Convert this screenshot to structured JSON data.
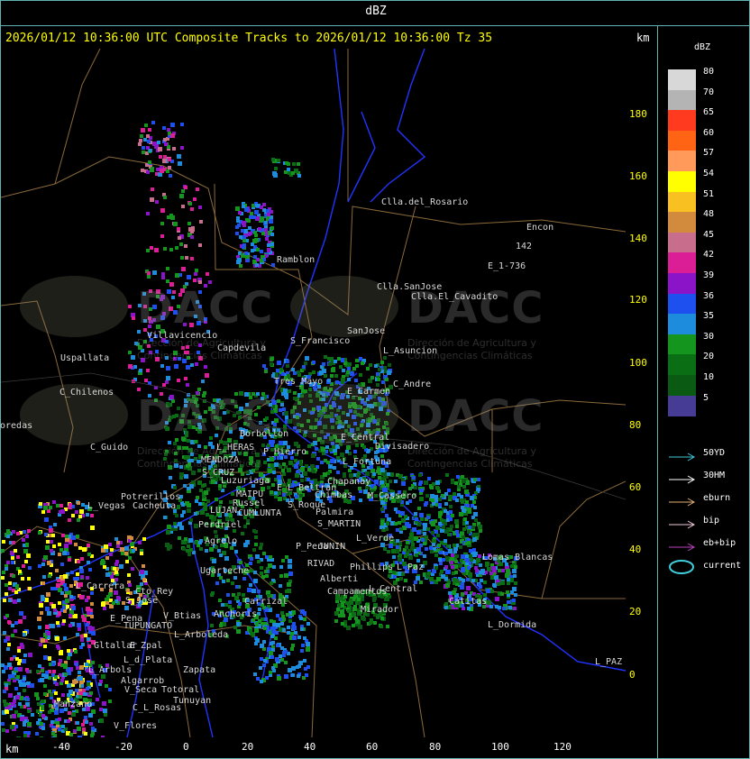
{
  "window": {
    "title": "dBZ",
    "header": "2026/01/12 10:36:00 UTC Composite Tracks to 2026/01/12 10:36:00 Tz 35",
    "km_label_top": "km",
    "km_label_bottom": "km"
  },
  "axes": {
    "y_ticks": [
      "180",
      "160",
      "140",
      "120",
      "100",
      "80",
      "60",
      "40",
      "20",
      "0"
    ],
    "x_ticks": [
      "-40",
      "-20",
      "0",
      "20",
      "40",
      "60",
      "80",
      "100",
      "120"
    ]
  },
  "legend": {
    "title": "dBZ",
    "levels": [
      {
        "label": "80",
        "color": "#d8d8d8"
      },
      {
        "label": "70",
        "color": "#b4b4b4"
      },
      {
        "label": "65",
        "color": "#ff3a1e"
      },
      {
        "label": "60",
        "color": "#ff6414"
      },
      {
        "label": "57",
        "color": "#ff9a5a"
      },
      {
        "label": "54",
        "color": "#ffff00"
      },
      {
        "label": "51",
        "color": "#f8c020"
      },
      {
        "label": "48",
        "color": "#d28a3c"
      },
      {
        "label": "45",
        "color": "#c86e8c"
      },
      {
        "label": "42",
        "color": "#dc1e96"
      },
      {
        "label": "39",
        "color": "#8c14c8"
      },
      {
        "label": "36",
        "color": "#1e50f0"
      },
      {
        "label": "35",
        "color": "#1e8cdc"
      },
      {
        "label": "30",
        "color": "#14961e"
      },
      {
        "label": "20",
        "color": "#0a6e14"
      },
      {
        "label": "10",
        "color": "#0a5a14"
      },
      {
        "label": "5",
        "color": "#463c96"
      }
    ],
    "tracks": [
      {
        "label": "50YD",
        "color": "#40c8d8"
      },
      {
        "label": "30HM",
        "color": "#ffffff"
      },
      {
        "label": "eburn",
        "color": "#e0b070"
      },
      {
        "label": "bip",
        "color": "#f0c8d8"
      },
      {
        "label": "eb+bip",
        "color": "#c040c0"
      },
      {
        "label": "current",
        "color": "#40d0e0"
      }
    ]
  },
  "watermark": {
    "brand": "DACC",
    "line1": "Dirección de Agricultura",
    "line2": "y Contingencias Climáticas"
  },
  "places": [
    "Clla.del_Rosario",
    "Encon",
    "142",
    "E_1-736",
    "Ramblon",
    "Clla.SanJose",
    "Clla.El_Cavadito",
    "Villavicencio",
    "Uspallata",
    "C_Chilenos",
    "Capdevila",
    "S_Francisco",
    "SanJose",
    "L_Asuncion",
    "Tres_Mayo",
    "C_Andre",
    "E_Carmen",
    "oredas",
    "C_Guido",
    "L_HERAS",
    "Borbollon",
    "P_Hierro",
    "Divisadero",
    "E_Central",
    "L_Fortuna",
    "MENDOZA",
    "S_CRUZ",
    "Luzuriaga",
    "Chapanay",
    "E_L_Beltran",
    "M_Cassero",
    "Potrerillos",
    "L_Vegas",
    "Cacheuta",
    "MAIPU",
    "Russel",
    "LUJAN",
    "CUMLUNTA",
    "Chimbas",
    "S_Roque",
    "Palmira",
    "S_MARTIN",
    "Perdriel",
    "Agrelo",
    "L_Verde",
    "P_Pena",
    "JUNIN",
    "RIVAD",
    "Phillips",
    "L_Paz",
    "Ugarteche",
    "Lomas_Blancas",
    "L_Carrera",
    "Cto_Rey",
    "S_Jose",
    "Alberti",
    "Campamentos",
    "L_Central",
    "Catitas",
    "E_Pena",
    "TUPUNGATO",
    "Anchoris",
    "Carrizal",
    "V_Btias",
    "L_Arboleda",
    "Mirador",
    "L_Dormida",
    "Gltallar",
    "E_Zpal",
    "L_d_Plata",
    "Zapata",
    "L_Arbols",
    "L_PAZ",
    "Tunuyan",
    "V_Seca",
    "C_L_Rosas",
    "Manzano",
    "V_Flores",
    "Algarrob",
    "Totoral"
  ]
}
